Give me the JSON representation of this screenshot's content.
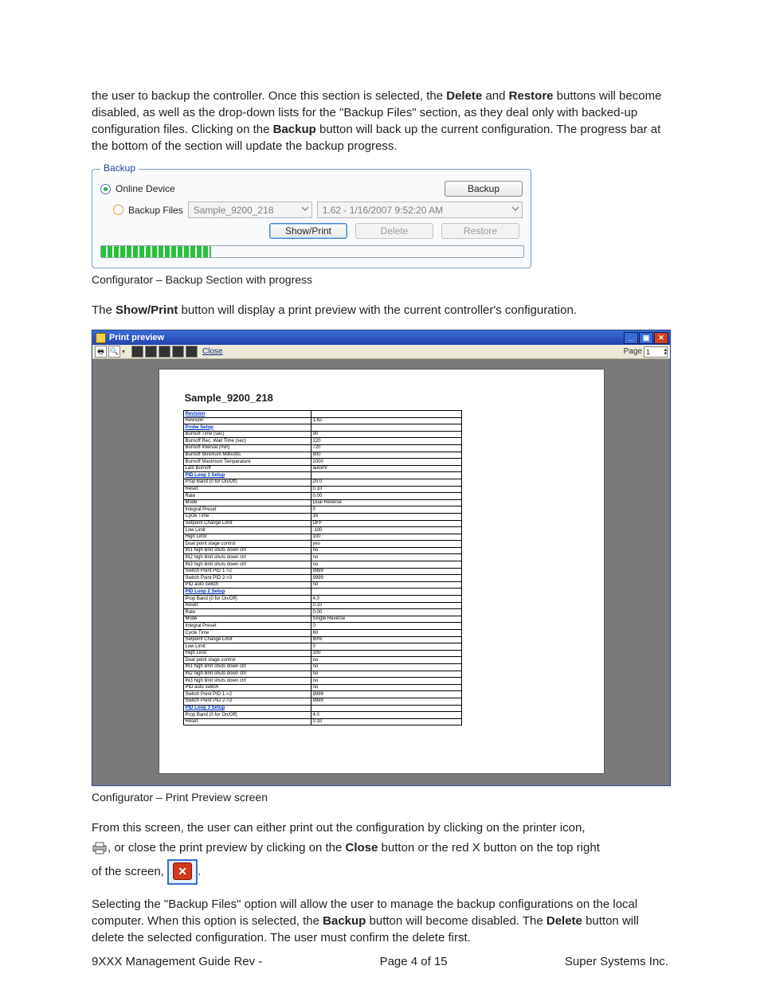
{
  "text": {
    "para1_a": "the user to backup the controller.  Once this section is selected, the ",
    "delete_bold": "Delete",
    "para1_b": " and ",
    "restore_bold": "Restore",
    "para1_c": " buttons will become disabled, as well as the drop-down lists for the \"Backup Files\" section, as they deal only with backed-up configuration files.  Clicking on the ",
    "backup_bold": "Backup",
    "para1_d": " button will back up the current configuration.  The progress bar at the bottom of the section will update the backup progress.",
    "caption1": "Configurator – Backup Section with progress",
    "para2_a": "The ",
    "showprint_bold": "Show/Print",
    "para2_b": " button will display a print preview with the current controller's configuration.",
    "caption2": "Configurator – Print Preview screen",
    "para3": "From this screen, the user can either print out the configuration by clicking on the printer icon,",
    "para3b_a": ", or close the print preview by clicking on the ",
    "close_bold": "Close",
    "para3b_b": " button or the red X button on the top right",
    "para3c_a": "of the screen, ",
    "para3c_b": ".",
    "para4_a": "Selecting the \"Backup Files\" option will allow the user to manage the backup configurations on the local computer.  When this option is selected, the ",
    "backup_bold2": "Backup",
    "para4_b": " button will become disabled.  The ",
    "delete_bold2": "Delete",
    "para4_c": " button will delete the selected configuration.  The user must confirm the delete first."
  },
  "backup_panel": {
    "legend": "Backup",
    "online_label": "Online Device",
    "backup_files_label": "Backup Files",
    "file_name": "Sample_9200_218",
    "file_date": "1.62 - 1/16/2007 9:52:20 AM",
    "btn_backup": "Backup",
    "btn_showprint": "Show/Print",
    "btn_delete": "Delete",
    "btn_restore": "Restore"
  },
  "print_preview": {
    "title": "Print preview",
    "toolbar_close": "Close",
    "page_label": "Page",
    "page_value": "1",
    "doc_title": "Sample_9200_218",
    "rows": [
      {
        "section": true,
        "k": "Revision",
        "v": ""
      },
      {
        "k": "Revision",
        "v": "1.62"
      },
      {
        "section": true,
        "k": "Probe Setup",
        "v": ""
      },
      {
        "k": "Burnoff Time (sec)",
        "v": "90"
      },
      {
        "k": "Burnoff Rec. Wait Time (sec)",
        "v": "120"
      },
      {
        "k": "Burnoff Interval (min)",
        "v": "720"
      },
      {
        "k": "Burnoff Minimum Millivolts",
        "v": "800"
      },
      {
        "k": "Burnoff Maximum Temperature",
        "v": "2000"
      },
      {
        "k": "Last Burnoff",
        "v": "automt"
      },
      {
        "section": true,
        "k": "PID Loop 1 Setup",
        "v": ""
      },
      {
        "k": "Prop Band (0 for On/Off)",
        "v": "20.0"
      },
      {
        "k": "Reset",
        "v": "0.10"
      },
      {
        "k": "Rate",
        "v": "0.00"
      },
      {
        "k": "Mode",
        "v": "Dual Reverse"
      },
      {
        "k": "Integral Preset",
        "v": "0"
      },
      {
        "k": "Cycle Time",
        "v": "16"
      },
      {
        "k": "Setpoint Change Limit",
        "v": "OFF"
      },
      {
        "k": "Low Limit",
        "v": "-100"
      },
      {
        "k": "High Limit",
        "v": "100"
      },
      {
        "k": "Dual point stage control",
        "v": "yes"
      },
      {
        "k": "IN1 high limit shuts down ctrl",
        "v": "no"
      },
      {
        "k": "IN2 high limit shuts down ctrl",
        "v": "no"
      },
      {
        "k": "IN3 high limit shuts down ctrl",
        "v": "no"
      },
      {
        "k": "Switch Point PID 1->2",
        "v": "9999"
      },
      {
        "k": "Switch Point PID 2->3",
        "v": "9999"
      },
      {
        "k": "PID auto switch",
        "v": "no"
      },
      {
        "section": true,
        "k": "PID Loop 2 Setup",
        "v": ""
      },
      {
        "k": "Prop Band (0 for On/Off)",
        "v": "4.0"
      },
      {
        "k": "Reset",
        "v": "0.10"
      },
      {
        "k": "Rate",
        "v": "0.00"
      },
      {
        "k": "Mode",
        "v": "Single Reverse"
      },
      {
        "k": "Integral Preset",
        "v": "0"
      },
      {
        "k": "Cycle Time",
        "v": "60"
      },
      {
        "k": "Setpoint Change Limit",
        "v": "80%"
      },
      {
        "k": "Low Limit",
        "v": "0"
      },
      {
        "k": "High Limit",
        "v": "100"
      },
      {
        "k": "Dual point stage control",
        "v": "no"
      },
      {
        "k": "IN1 high limit shuts down ctrl",
        "v": "no"
      },
      {
        "k": "IN2 high limit shuts down ctrl",
        "v": "no"
      },
      {
        "k": "IN3 high limit shuts down ctrl",
        "v": "no"
      },
      {
        "k": "PID auto switch",
        "v": "no"
      },
      {
        "k": "Switch Point PID 1->2",
        "v": "9999"
      },
      {
        "k": "Switch Point PID 2->3",
        "v": "9999"
      },
      {
        "section": true,
        "k": "PID Loop 3 Setup",
        "v": ""
      },
      {
        "k": "Prop Band (0 for On/Off)",
        "v": "4.0"
      },
      {
        "k": "Reset",
        "v": "0.10"
      }
    ]
  },
  "footer": {
    "left": "9XXX Management Guide Rev -",
    "center": "Page 4 of 15",
    "right": "Super Systems Inc."
  }
}
